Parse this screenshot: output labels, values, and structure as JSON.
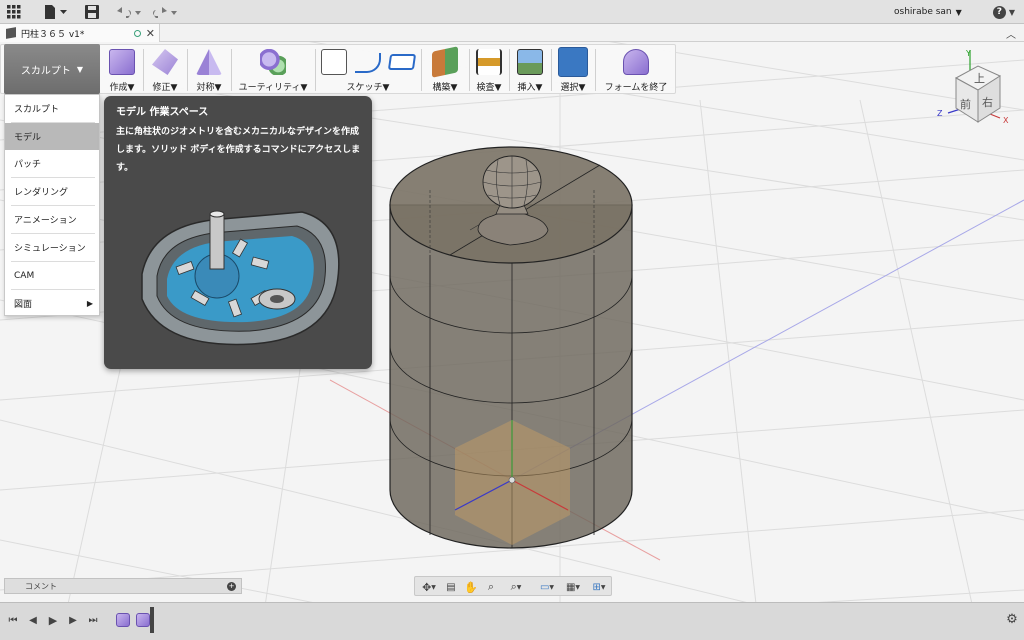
{
  "app": {
    "user": "oshirabe san",
    "help": "?"
  },
  "tab": {
    "title": "円柱３６５ v1*"
  },
  "workspace": {
    "label": "スカルプト",
    "menu": [
      "スカルプト",
      "モデル",
      "パッチ",
      "レンダリング",
      "アニメーション",
      "シミュレーション",
      "CAM",
      "図面"
    ],
    "selected_index": 1
  },
  "ribbon": {
    "groups": [
      "作成▼",
      "修正▼",
      "対称▼",
      "ユーティリティ▼",
      "スケッチ▼",
      "構築▼",
      "検査▼",
      "挿入▼",
      "選択▼",
      "フォームを終了"
    ]
  },
  "tooltip": {
    "title": "モデル 作業スペース",
    "body": "主に角柱状のジオメトリを含むメカニカルなデザインを作成します。ソリッド ボディを作成するコマンドにアクセスします。"
  },
  "viewcube": {
    "top": "上",
    "front": "前",
    "right": "右",
    "axis_x": "X",
    "axis_y": "Y",
    "axis_z": "Z"
  },
  "comments": {
    "label": "コメント"
  },
  "colors": {
    "ribbon_bg": "#f8f8f8",
    "ws_button": "#7a7a7a",
    "tooltip_bg": "#4a4a4a",
    "body_fill": "#6a6256",
    "selection_accent": "#3a78c2"
  }
}
